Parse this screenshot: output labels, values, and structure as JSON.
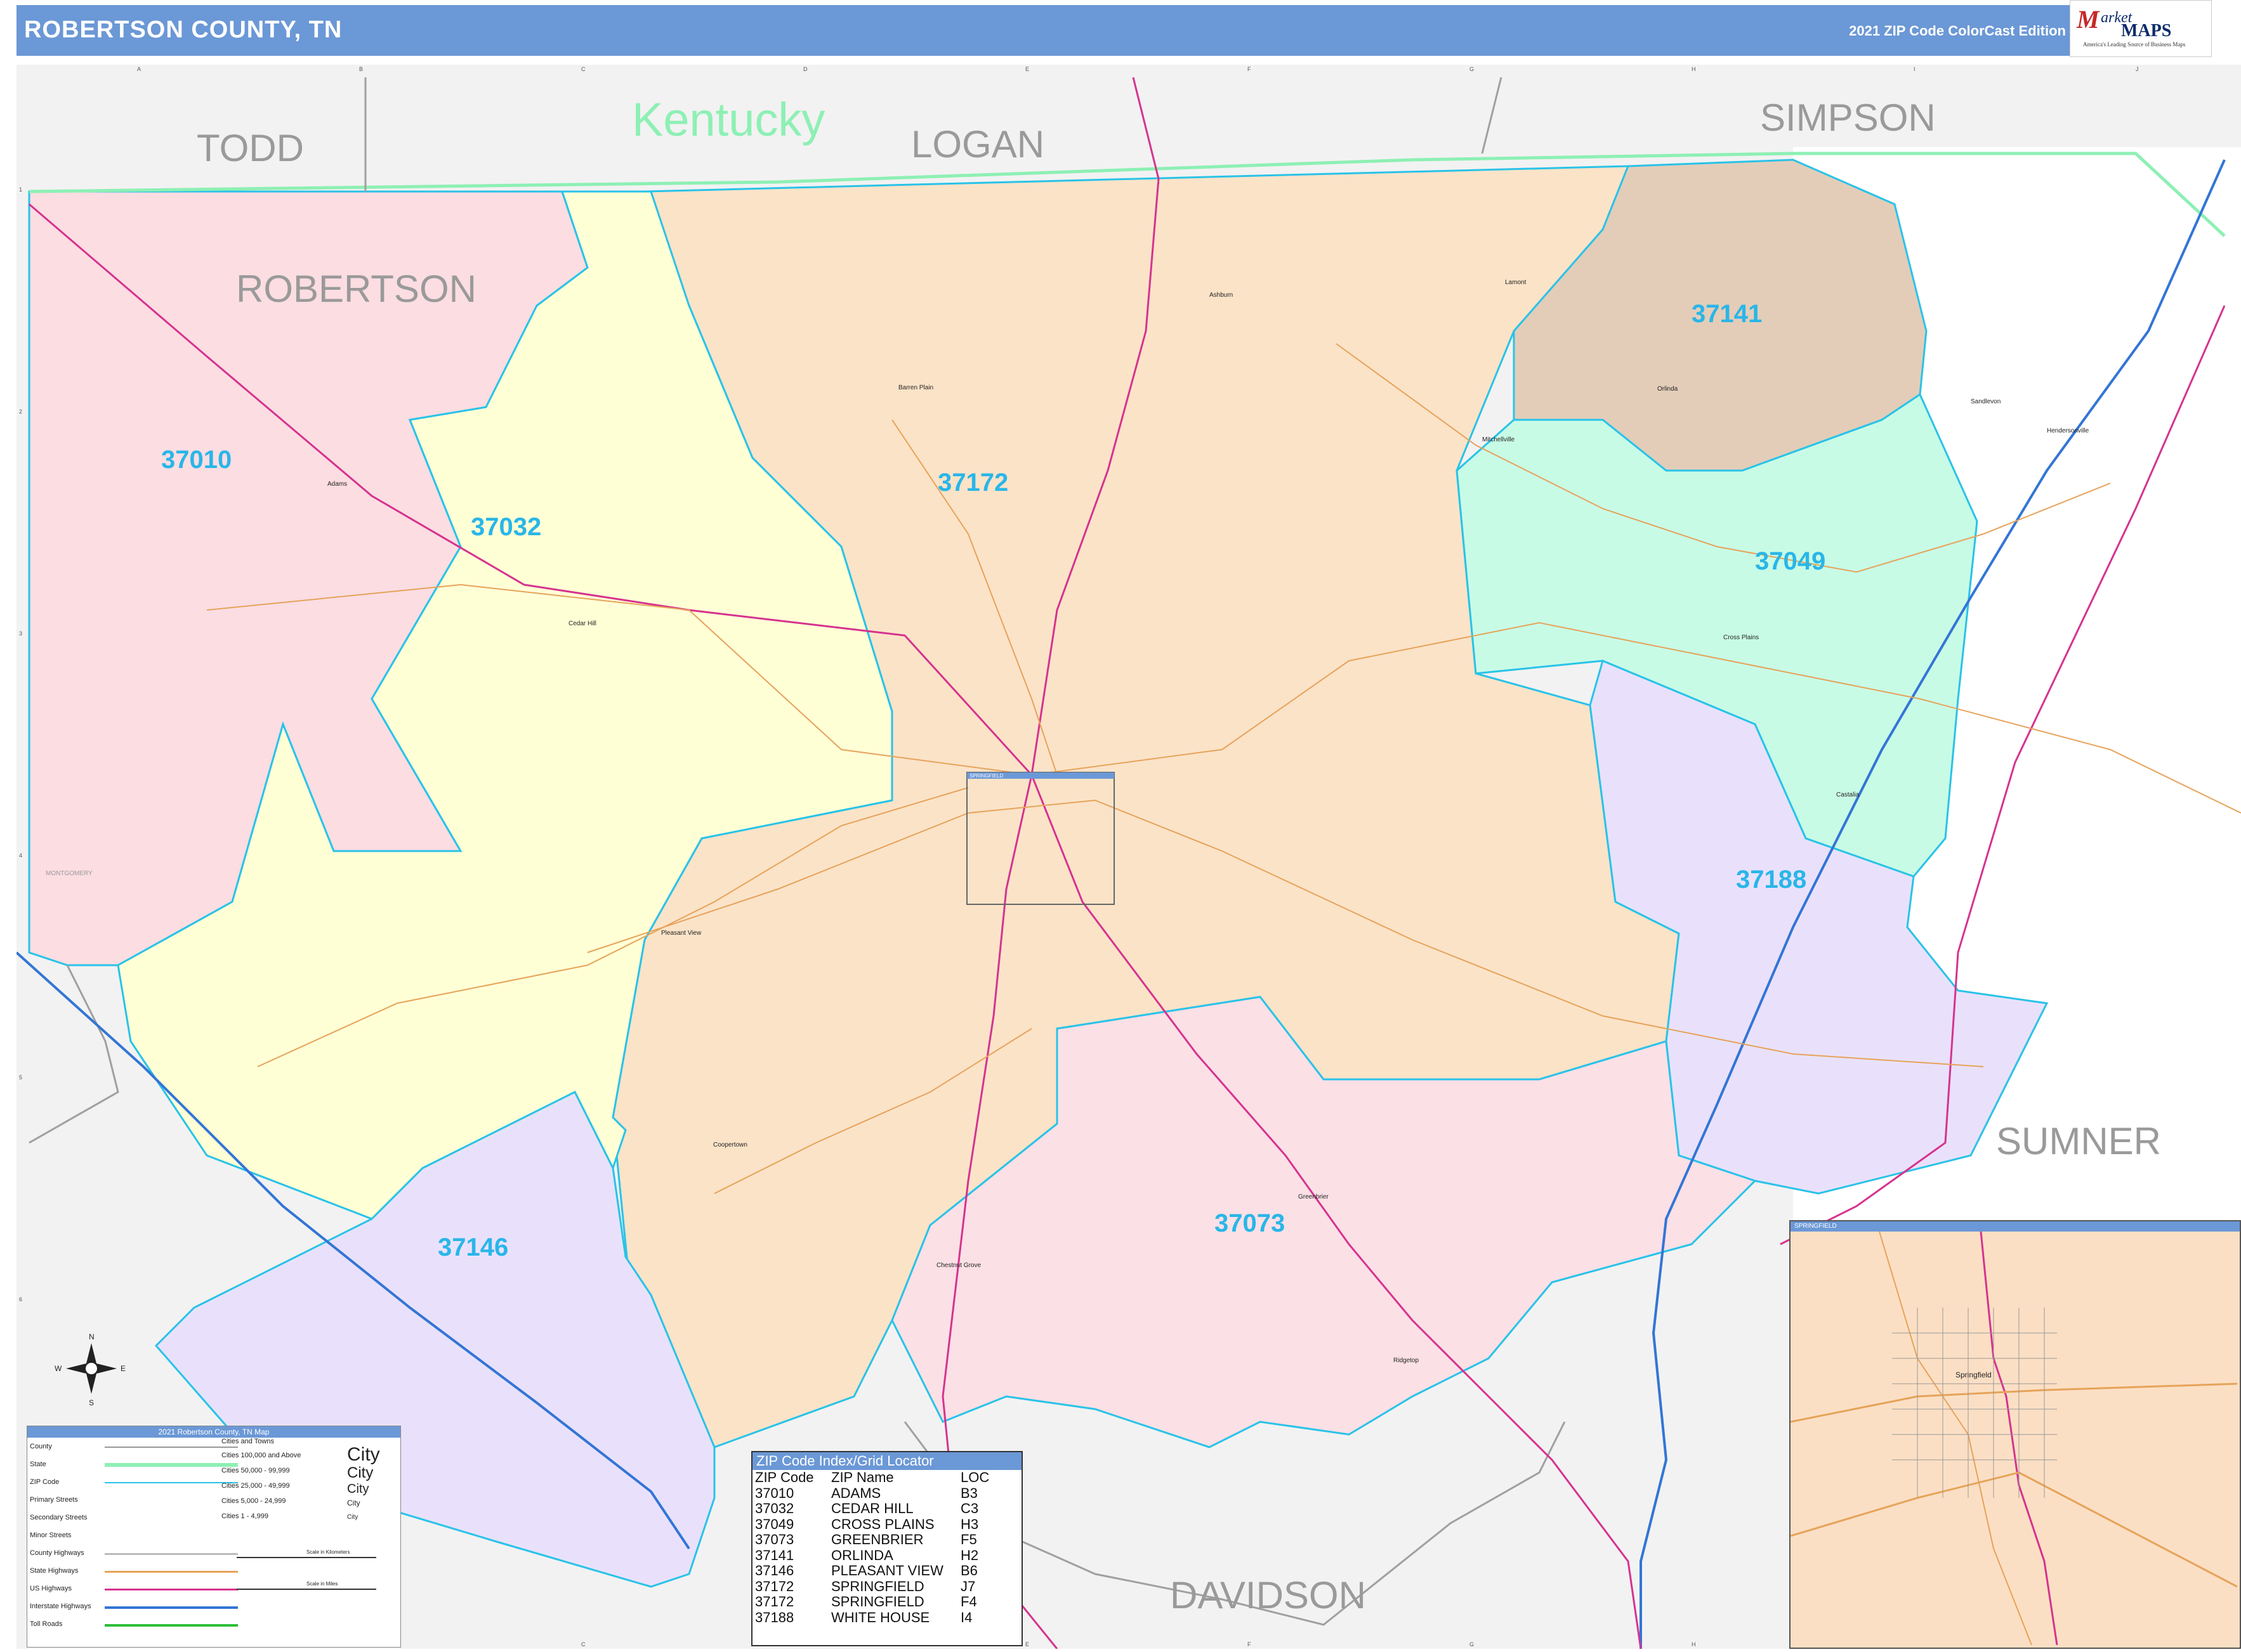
{
  "header": {
    "title": "ROBERTSON COUNTY, TN",
    "edition": "2021 ZIP Code ColorCast Edition"
  },
  "logo": {
    "m": "M",
    "arket": "arket",
    "maps": "MAPS",
    "tagline": "America's Leading Source of Business Maps"
  },
  "map": {
    "neighbors": {
      "todd": "TODD",
      "logan": "LOGAN",
      "simpson": "SIMPSON",
      "robertson": "ROBERTSON",
      "sumner": "SUMNER",
      "davidson": "DAVIDSON",
      "montgomery": "MONTGOMERY"
    },
    "state_label": "Kentucky",
    "zip_labels": {
      "z37010": "37010",
      "z37032": "37032",
      "z37172": "37172",
      "z37141": "37141",
      "z37049": "37049",
      "z37188": "37188",
      "z37073": "37073",
      "z37146": "37146"
    },
    "towns": {
      "adams": "Adams",
      "cedar_hill": "Cedar Hill",
      "barren_plain": "Barren Plain",
      "ashburn": "Ashburn",
      "lamont": "Lamont",
      "orlinda": "Orlinda",
      "mitchellville": "Mitchellville",
      "cross_plains": "Cross Plains",
      "coopertown": "Coopertown",
      "chestnut_grove": "Chestnut Grove",
      "greenbrier": "Greenbrier",
      "ridgetop": "Ridgetop",
      "pleasant_view": "Pleasant View",
      "castalia": "Castalia",
      "sandlevon": "Sandlevon",
      "hendersonville": "Hendersonville",
      "springfield": "SPRINGFIELD"
    },
    "colors": {
      "z37010": "#fbdde2",
      "z37032": "#ffffd6",
      "z37172": "#fbe3c8",
      "z37141": "#e3cdb9",
      "z37049": "#c8fbe6",
      "z37188": "#e9e1fb",
      "z37073": "#fbe0e6",
      "z37146": "#e9e1fb",
      "outside": "#f2f2f2",
      "zip_border": "#29c3e8",
      "state_line": "#8df0b4",
      "zip_text": "#29b6e8",
      "interstate": "#3375d6",
      "us_highway": "#d6338f",
      "state_highway": "#e6a35a"
    }
  },
  "legend": {
    "title": "2021 Robertson County, TN Map",
    "items": [
      "County",
      "State",
      "ZIP Code",
      "Primary Streets",
      "Secondary Streets",
      "Minor Streets",
      "County Highways",
      "State Highways",
      "US Highways",
      "Interstate Highways",
      "Toll Roads"
    ],
    "cities_header": "Cities and Towns",
    "cities": [
      "Cities 100,000 and Above",
      "Cities 50,000 - 99,999",
      "Cities 25,000 - 49,999",
      "Cities 5,000 - 24,999",
      "Cities 1 - 4,999"
    ],
    "city_sample": "City",
    "scale_km": "Scale in Kilometers",
    "scale_mi": "Scale in Miles"
  },
  "zip_index": {
    "title": "ZIP Code Index/Grid Locator",
    "headers": [
      "ZIP Code",
      "ZIP Name",
      "LOC"
    ],
    "rows": [
      [
        "37010",
        "ADAMS",
        "B3"
      ],
      [
        "37032",
        "CEDAR HILL",
        "C3"
      ],
      [
        "37049",
        "CROSS PLAINS",
        "H3"
      ],
      [
        "37073",
        "GREENBRIER",
        "F5"
      ],
      [
        "37141",
        "ORLINDA",
        "H2"
      ],
      [
        "37146",
        "PLEASANT VIEW",
        "B6"
      ],
      [
        "37172",
        "SPRINGFIELD",
        "J7"
      ],
      [
        "37172",
        "SPRINGFIELD",
        "F4"
      ],
      [
        "37188",
        "WHITE HOUSE",
        "I4"
      ]
    ]
  },
  "inset": {
    "title": "SPRINGFIELD",
    "city": "Springfield"
  },
  "grid": {
    "cols": [
      "A",
      "B",
      "C",
      "D",
      "E",
      "F",
      "G",
      "H",
      "I",
      "J"
    ],
    "rows": [
      "1",
      "2",
      "3",
      "4",
      "5",
      "6"
    ]
  },
  "compass": {
    "n": "N",
    "s": "S",
    "e": "E",
    "w": "W"
  }
}
